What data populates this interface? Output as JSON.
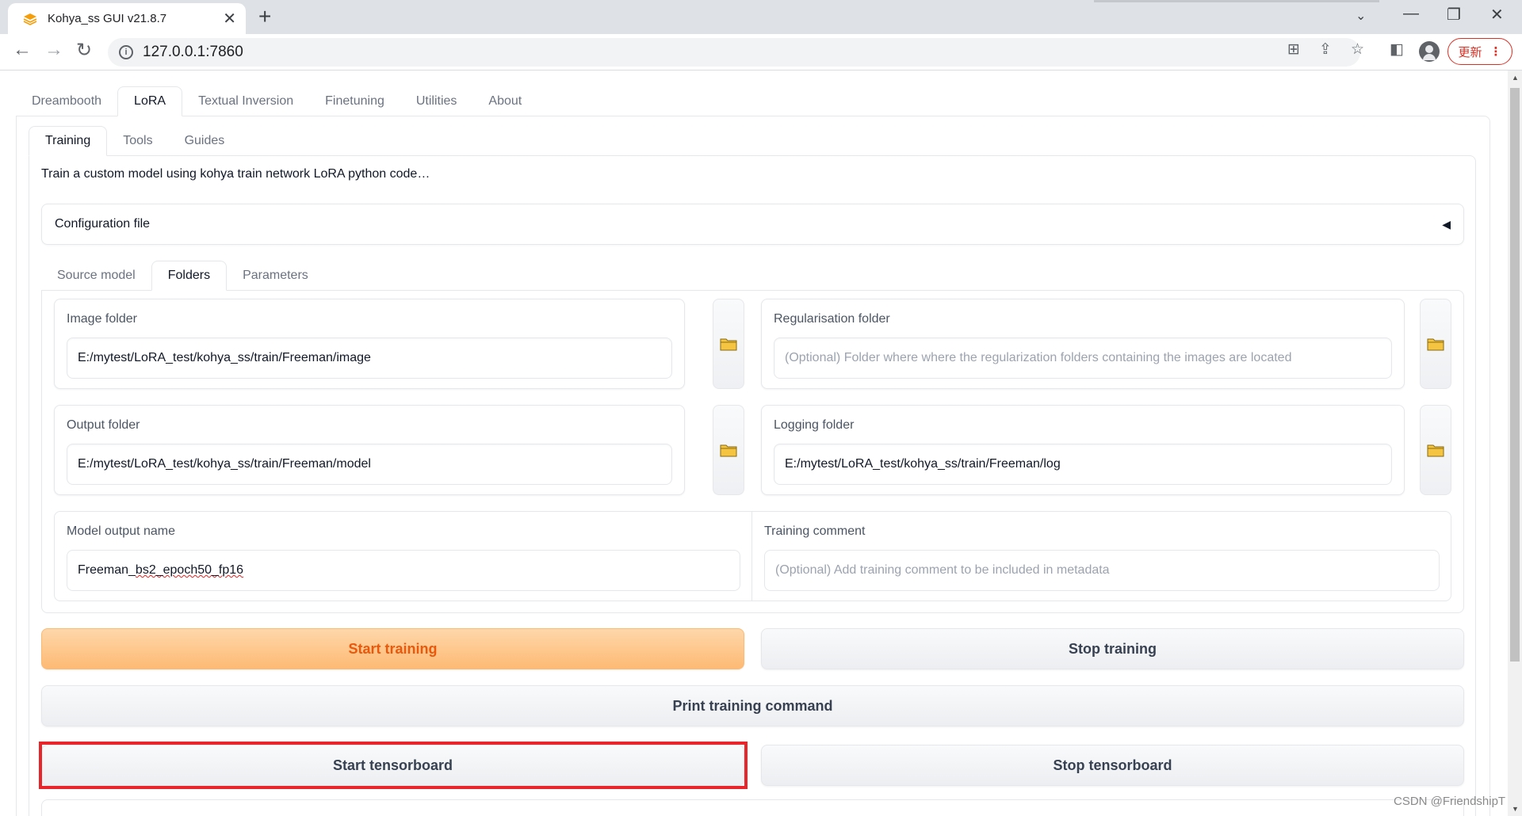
{
  "browser": {
    "tab_title": "Kohya_ss GUI v21.8.7",
    "url": "127.0.0.1:7860",
    "update_label": "更新"
  },
  "app": {
    "main_tabs": [
      "Dreambooth",
      "LoRA",
      "Textual Inversion",
      "Finetuning",
      "Utilities",
      "About"
    ],
    "main_selected": "LoRA",
    "sub_tabs": [
      "Training",
      "Tools",
      "Guides"
    ],
    "sub_selected": "Training",
    "description": "Train a custom model using kohya train network LoRA python code…",
    "config_accordion": "Configuration file",
    "section_tabs": [
      "Source model",
      "Folders",
      "Parameters"
    ],
    "section_selected": "Folders"
  },
  "folders": {
    "image_folder": {
      "label": "Image folder",
      "value": "E:/mytest/LoRA_test/kohya_ss/train/Freeman/image"
    },
    "reg_folder": {
      "label": "Regularisation folder",
      "placeholder": "(Optional) Folder where where the regularization folders containing the images are located"
    },
    "output_folder": {
      "label": "Output folder",
      "value": "E:/mytest/LoRA_test/kohya_ss/train/Freeman/model"
    },
    "logging_folder": {
      "label": "Logging folder",
      "value": "E:/mytest/LoRA_test/kohya_ss/train/Freeman/log"
    },
    "model_output_name": {
      "label": "Model output name",
      "value_prefix": "Freeman_",
      "value_marked": "bs2_epoch50_fp16"
    },
    "training_comment": {
      "label": "Training comment",
      "placeholder": "(Optional) Add training comment to be included in metadata"
    }
  },
  "actions": {
    "start_training": "Start training",
    "stop_training": "Stop training",
    "print_command": "Print training command",
    "start_tensorboard": "Start tensorboard",
    "stop_tensorboard": "Stop tensorboard"
  },
  "watermark": "CSDN @FriendshipT",
  "colors": {
    "primary_button": "#fdba74",
    "primary_text": "#ea580c",
    "highlight_box": "#e8252a",
    "folder_icon": "#f5c542"
  },
  "icons": [
    "back-arrow-icon",
    "forward-arrow-icon",
    "reload-icon",
    "info-icon",
    "translate-icon",
    "share-icon",
    "star-icon",
    "sidebar-icon",
    "profile-icon",
    "kebab-menu-icon",
    "folder-icon",
    "collapse-arrow-icon"
  ]
}
